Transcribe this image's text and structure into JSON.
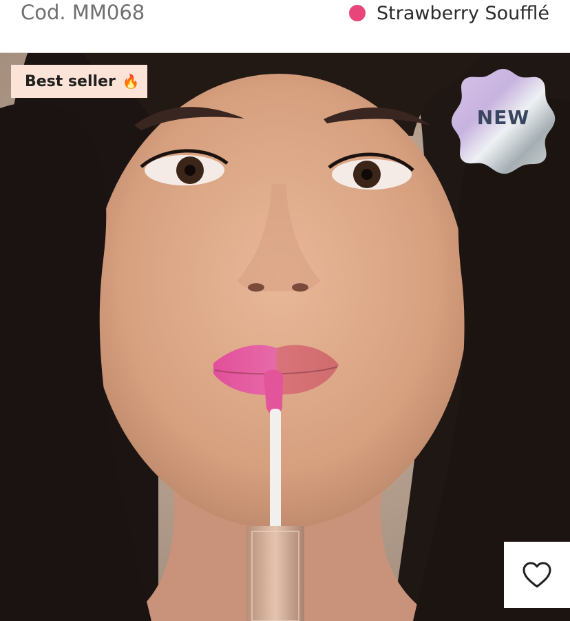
{
  "product": {
    "code_prefix": "Cod.",
    "code_value": "MM068",
    "shade_name": "Strawberry Soufflé",
    "shade_color": "#e8457a"
  },
  "hero": {
    "image_description_icon": "model-photo"
  },
  "badges": {
    "best_seller_label": "Best seller",
    "best_seller_icon": "fire-icon",
    "new_label": "NEW"
  },
  "actions": {
    "favorite_icon": "heart-outline-icon"
  }
}
